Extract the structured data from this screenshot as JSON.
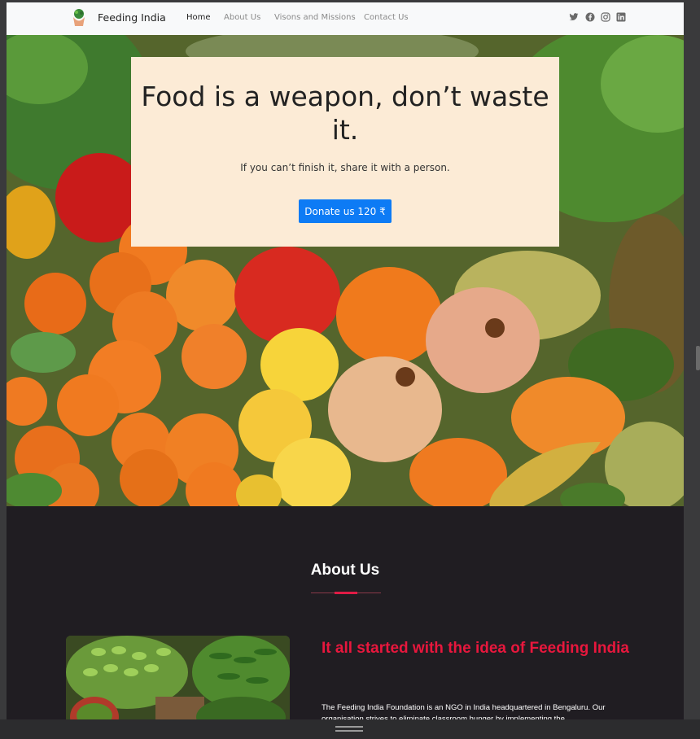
{
  "nav": {
    "brand": "Feeding India",
    "links": [
      {
        "label": "Home",
        "active": true
      },
      {
        "label": "About Us",
        "active": false
      },
      {
        "label": "Visons and Missions",
        "active": false
      },
      {
        "label": "Contact Us",
        "active": false
      }
    ],
    "social": [
      "twitter-icon",
      "facebook-icon",
      "instagram-icon",
      "linkedin-icon"
    ]
  },
  "hero": {
    "headline": "Food is a weapon, don’t waste it.",
    "subtext": "If you can’t finish it, share it with a person.",
    "donate_label": "Donate us 120 ₹",
    "card_color": "#fcebd6",
    "button_color": "#0d7bf5"
  },
  "about": {
    "title": "About Us",
    "heading": "It all started with the idea of Feeding India",
    "body": "The Feeding India Foundation is an NGO in India headquartered in Bengaluru. Our organisation strives to eliminate classroom hunger by implementing the",
    "accent_color": "#e01b45"
  }
}
